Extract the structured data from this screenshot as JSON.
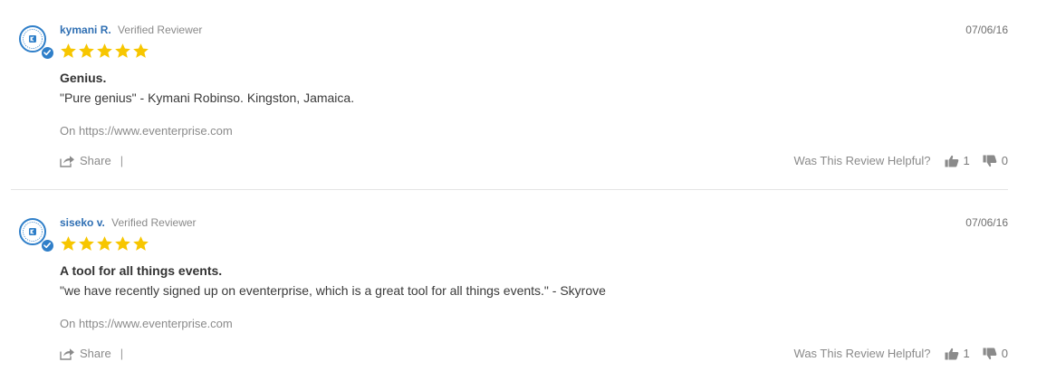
{
  "reviews": [
    {
      "name": "kymani R.",
      "verified_label": "Verified Reviewer",
      "date": "07/06/16",
      "rating": 5,
      "title": "Genius.",
      "body": "\"Pure genius\" - Kymani Robinso. Kingston, Jamaica.",
      "source": "On https://www.eventerprise.com",
      "share_label": "Share",
      "share_separator": "|",
      "helpful_label": "Was This Review Helpful?",
      "votes_up": "1",
      "votes_down": "0"
    },
    {
      "name": "siseko v.",
      "verified_label": "Verified Reviewer",
      "date": "07/06/16",
      "rating": 5,
      "title": "A tool for all things events.",
      "body": "\"we have recently signed up on eventerprise, which is a great tool for all things events.\" - Skyrove",
      "source": "On https://www.eventerprise.com",
      "share_label": "Share",
      "share_separator": "|",
      "helpful_label": "Was This Review Helpful?",
      "votes_up": "1",
      "votes_down": "0"
    }
  ],
  "colors": {
    "name": "#2f6fb3",
    "verified_badge": "#2f7fc9",
    "star": "#f7c600",
    "muted_text": "#8a8a8a",
    "divider": "#e4e4e4"
  },
  "icons": {
    "avatar": "verified-reviewer-seal-icon",
    "badge": "checkmark-icon",
    "rating": "star-icon",
    "share": "share-icon",
    "vote_up": "thumbs-up-icon",
    "vote_down": "thumbs-down-icon"
  }
}
